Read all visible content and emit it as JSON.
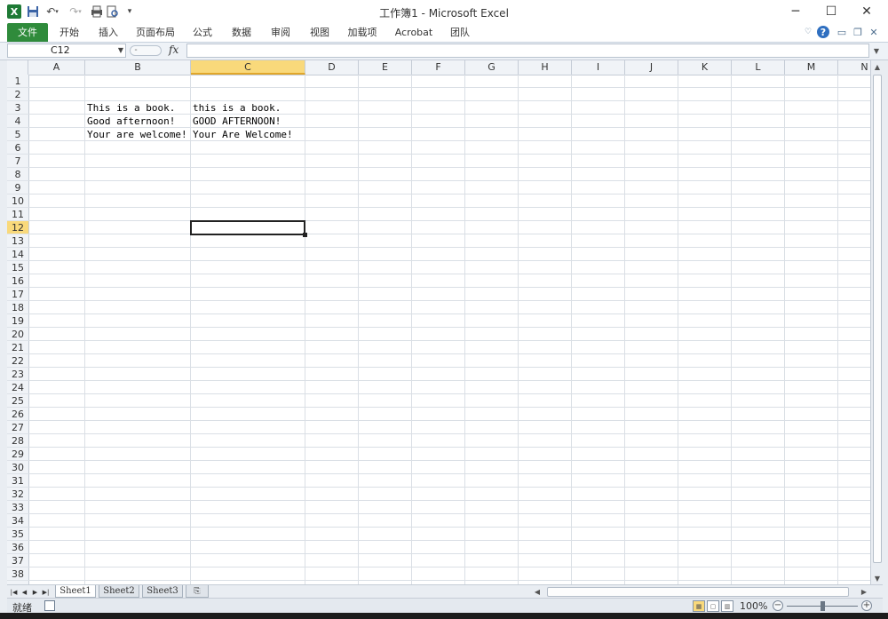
{
  "window": {
    "title": "工作簿1 - Microsoft Excel"
  },
  "ribbon": {
    "tabs": [
      "文件",
      "开始",
      "插入",
      "页面布局",
      "公式",
      "数据",
      "审阅",
      "视图",
      "加载项",
      "Acrobat",
      "团队"
    ]
  },
  "formula_bar": {
    "name_box": "C12",
    "fx_label": "fx",
    "formula": ""
  },
  "sheet": {
    "columns": [
      "A",
      "B",
      "C",
      "D",
      "E",
      "F",
      "G",
      "H",
      "I",
      "J",
      "K",
      "L",
      "M",
      "N"
    ],
    "selected_column": "C",
    "rows": [
      "1",
      "2",
      "3",
      "4",
      "5",
      "6",
      "7",
      "8",
      "9",
      "10",
      "11",
      "12",
      "13",
      "14",
      "15",
      "16",
      "17",
      "18",
      "19",
      "20",
      "21",
      "22",
      "23",
      "24",
      "25",
      "26",
      "27",
      "28",
      "29",
      "30",
      "31",
      "32",
      "33",
      "34",
      "35",
      "36",
      "37",
      "38"
    ],
    "selected_row": "12",
    "active_cell": "C12",
    "cells": [
      {
        "ref": "B3",
        "value": "This is a book."
      },
      {
        "ref": "C3",
        "value": "this is a book."
      },
      {
        "ref": "B4",
        "value": "Good afternoon!"
      },
      {
        "ref": "C4",
        "value": "GOOD AFTERNOON!"
      },
      {
        "ref": "B5",
        "value": "Your are welcome!"
      },
      {
        "ref": "C5",
        "value": "Your Are Welcome!"
      }
    ]
  },
  "sheet_tabs": [
    "Sheet1",
    "Sheet2",
    "Sheet3"
  ],
  "active_sheet": "Sheet1",
  "status": {
    "ready": "就绪",
    "zoom": "100%",
    "zoom_level_percent": 100
  },
  "colors": {
    "file_tab": "#2f8b3b",
    "selected_header": "#f9d97b",
    "grid_line": "#dadfe5"
  }
}
